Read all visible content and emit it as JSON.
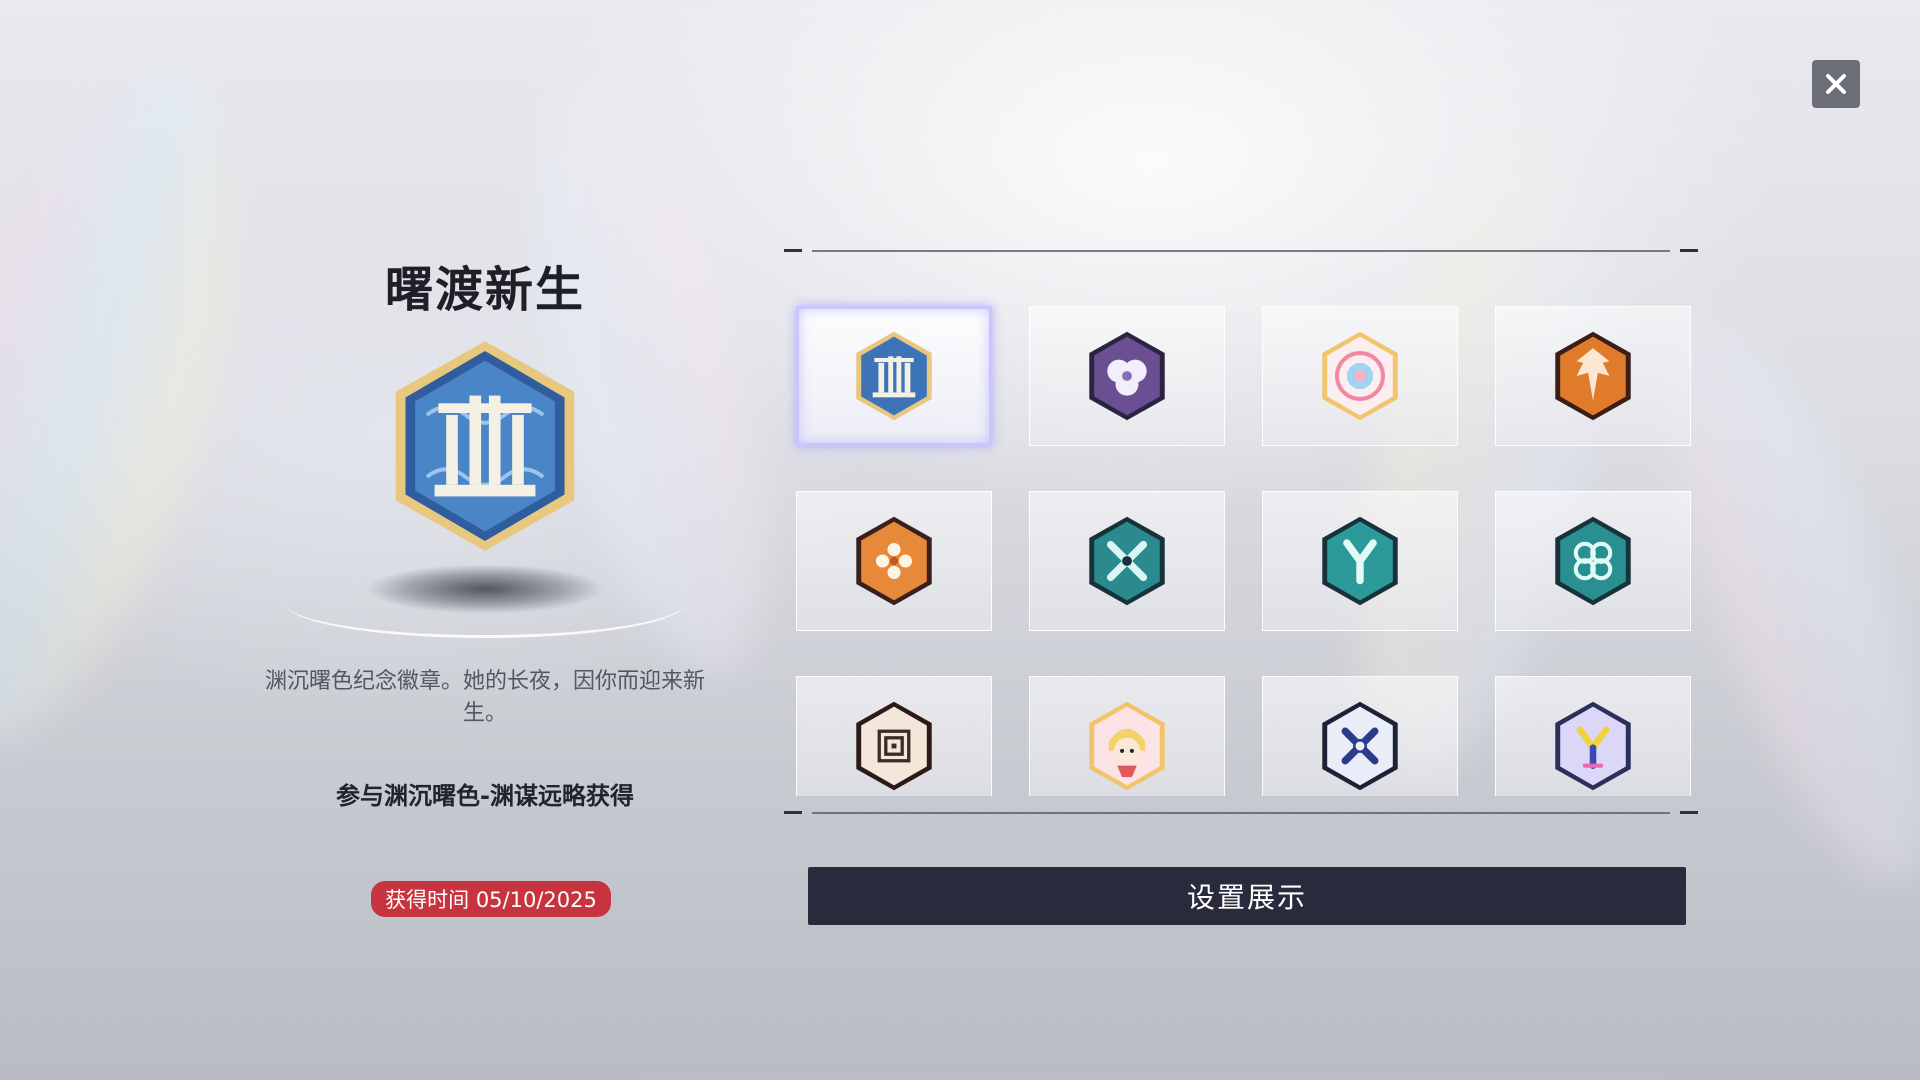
{
  "header": {
    "close_icon": "close-icon"
  },
  "detail": {
    "title": "曙渡新生",
    "badge_icon": "pillars-badge-icon",
    "description": "渊沉曙色纪念徽章。她的长夜，因你而迎来新生。",
    "source": "参与渊沉曙色-渊谋远略获得",
    "obtained_label": "获得时间 05/10/2025"
  },
  "colors": {
    "selected_border": "#c9c5ff",
    "button_bg": "#292a3b",
    "date_badge": "#c7343f"
  },
  "badges": [
    {
      "icon": "pillars-badge-icon",
      "selected": true
    },
    {
      "icon": "white-flower-badge-icon",
      "selected": false
    },
    {
      "icon": "pastel-ring-badge-icon",
      "selected": false
    },
    {
      "icon": "flame-crest-badge-icon",
      "selected": false
    },
    {
      "icon": "orange-blossom-badge-icon",
      "selected": false
    },
    {
      "icon": "teal-x-badge-icon",
      "selected": false
    },
    {
      "icon": "teal-y-badge-icon",
      "selected": false
    },
    {
      "icon": "teal-knot-badge-icon",
      "selected": false
    },
    {
      "icon": "maze-badge-icon",
      "selected": false
    },
    {
      "icon": "chibi-character-badge-icon",
      "selected": false
    },
    {
      "icon": "navy-x-badge-icon",
      "selected": false
    },
    {
      "icon": "holo-y-badge-icon",
      "selected": false
    }
  ],
  "actions": {
    "set_display_label": "设置展示"
  }
}
